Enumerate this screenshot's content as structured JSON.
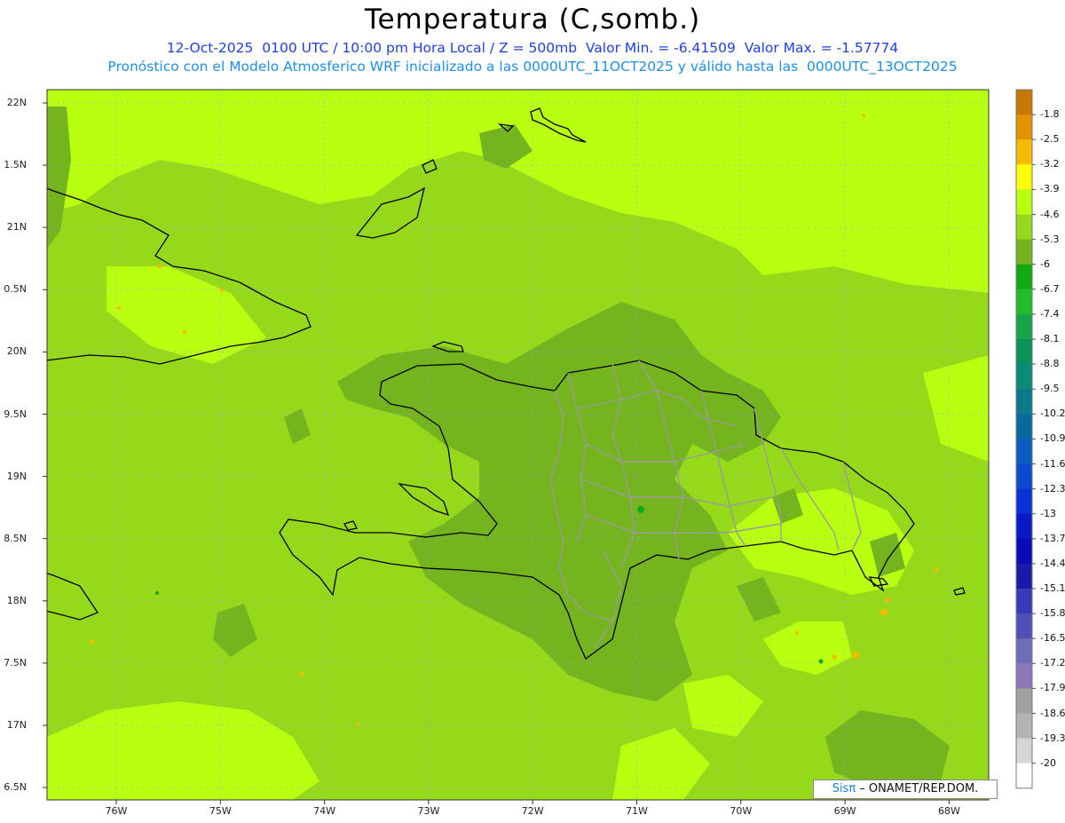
{
  "title": "Temperatura (C,somb.)",
  "subtitle_1": "12-Oct-2025  0100 UTC / 10:00 pm Hora Local / Z = 500mb  Valor Min. = -6.41509  Valor Max. = -1.57774",
  "subtitle_2": "Pronóstico con el Modelo Atmosferico WRF inicializado a las 0000UTC_11OCT2025 y válido hasta las  0000UTC_13OCT2025",
  "lat_labels": [
    "22N",
    "1.5N",
    "21N",
    "0.5N",
    "20N",
    "9.5N",
    "19N",
    "8.5N",
    "18N",
    "7.5N",
    "17N",
    "6.5N"
  ],
  "lon_labels": [
    "76W",
    "75W",
    "74W",
    "73W",
    "72W",
    "71W",
    "70W",
    "69W",
    "68W"
  ],
  "colorbar": {
    "labels": [
      "-1.8",
      "-2.5",
      "-3.2",
      "-3.9",
      "-4.6",
      "-5.3",
      "-6",
      "-6.7",
      "-7.4",
      "-8.1",
      "-8.8",
      "-9.5",
      "-10.2",
      "-10.9",
      "-11.6",
      "-12.3",
      "-13",
      "-13.7",
      "-14.4",
      "-15.1",
      "-15.8",
      "-16.5",
      "-17.2",
      "-17.9",
      "-18.6",
      "-19.3",
      "-20"
    ],
    "colors": [
      "#c87800",
      "#e29400",
      "#f5bb00",
      "#ffff00",
      "#b8ff10",
      "#96d81a",
      "#74b41e",
      "#12aa12",
      "#22be2a",
      "#18a448",
      "#0a925e",
      "#0a8a78",
      "#0a7a8c",
      "#0a6aa0",
      "#0a5cbe",
      "#0a4ad0",
      "#0a30d8",
      "#0a18c8",
      "#0a0ab8",
      "#1a1aa8",
      "#3a3ab8",
      "#5050b8",
      "#6e6eb8",
      "#8c78b8",
      "#a0a0a0",
      "#b4b4b4",
      "#d6d6d6",
      "#ffffff"
    ]
  },
  "field_colors": {
    "light": "#b8ff10",
    "medium": "#96d81a",
    "dark": "#74b41e",
    "hot": "#f5bb00",
    "cold": "#12aa12"
  },
  "credit": {
    "sis": "Sisπ",
    "org": " – ONAMET/REP.DOM."
  }
}
